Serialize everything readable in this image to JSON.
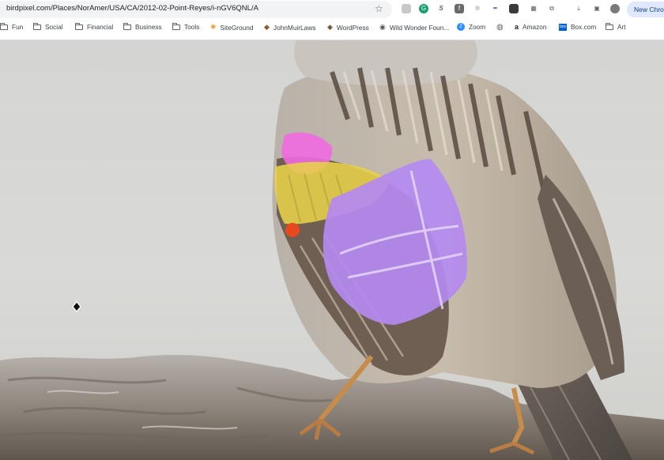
{
  "browser": {
    "url": "birdpixel.com/Places/NorAmer/USA/CA/2012-02-Point-Reyes/i-nGV6QNL/A",
    "new_chrome_label": "New Chro",
    "bookmark_icon": "star-icon",
    "extensions": [
      "ext-1",
      "ext-grammarly",
      "ext-s",
      "ext-facebook",
      "ext-spark",
      "ext-feather",
      "ext-dashlane",
      "ext-qr",
      "ext-puzzle",
      "ext-download",
      "ext-sidebar",
      "ext-profile"
    ]
  },
  "bookmarks": [
    {
      "label": "Fun",
      "icon": "folder-icon"
    },
    {
      "label": "Social",
      "icon": "folder-icon"
    },
    {
      "label": "Financial",
      "icon": "folder-icon"
    },
    {
      "label": "Business",
      "icon": "folder-icon"
    },
    {
      "label": "Tools",
      "icon": "folder-icon"
    },
    {
      "label": "SiteGround",
      "icon": "siteground-icon"
    },
    {
      "label": "JohnMuirLaws",
      "icon": "johnmuirlaws-icon"
    },
    {
      "label": "WordPress",
      "icon": "wordpress-icon"
    },
    {
      "label": "Wild Wonder Foun...",
      "icon": "wildwonder-icon"
    },
    {
      "label": "Zoom",
      "icon": "zoom-icon"
    },
    {
      "label": "",
      "icon": "globe-icon"
    },
    {
      "label": "Amazon",
      "icon": "amazon-icon"
    },
    {
      "label": "Box.com",
      "icon": "box-icon"
    },
    {
      "label": "Art",
      "icon": "folder-icon"
    }
  ],
  "colors": {
    "pink_patch": "#f06adf",
    "yellow_patch": "#e8d24a",
    "purple_patch": "#b48af0",
    "red_patch": "#e8481e",
    "background": "#d8d8d6"
  }
}
